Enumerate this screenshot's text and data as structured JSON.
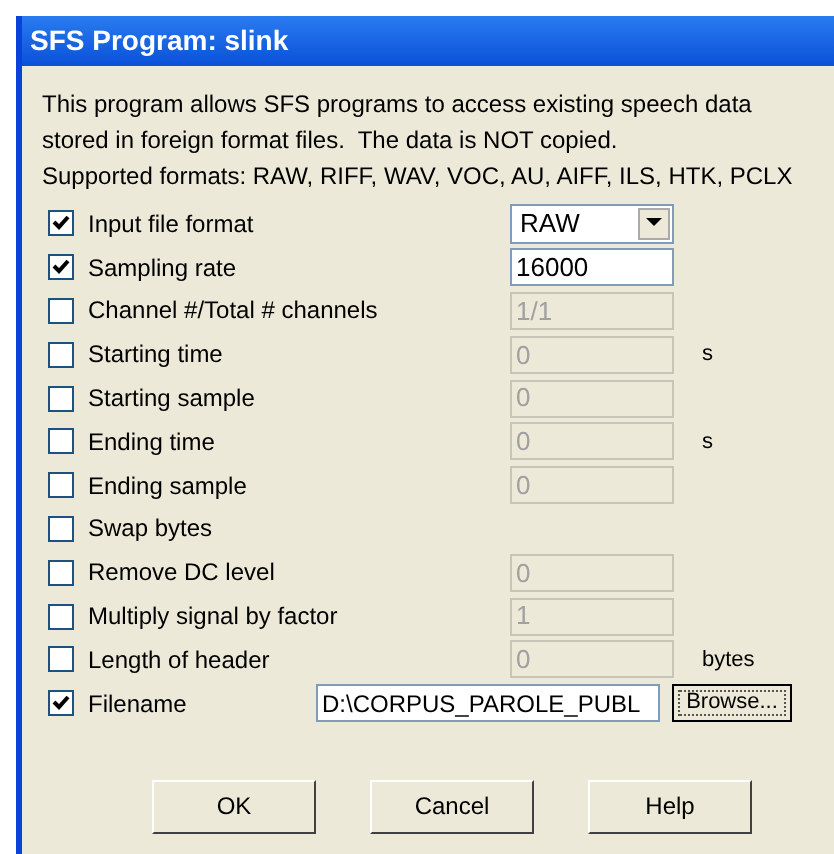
{
  "window": {
    "title": "SFS Program: slink"
  },
  "description": [
    "This program allows SFS programs to access existing speech data",
    "stored in foreign format files.  The data is NOT copied.",
    "Supported formats: RAW, RIFF, WAV, VOC, AU, AIFF, ILS, HTK, PCLX"
  ],
  "options": [
    {
      "label": "Input file format",
      "checked": true,
      "kind": "select",
      "value": "RAW",
      "disabled": false
    },
    {
      "label": "Sampling rate",
      "checked": true,
      "kind": "input",
      "value": "16000",
      "disabled": false
    },
    {
      "label": "Channel #/Total # channels",
      "checked": false,
      "kind": "input",
      "value": "1/1",
      "disabled": true
    },
    {
      "label": "Starting time",
      "checked": false,
      "kind": "input",
      "value": "0",
      "disabled": true,
      "unit": "s"
    },
    {
      "label": "Starting sample",
      "checked": false,
      "kind": "input",
      "value": "0",
      "disabled": true
    },
    {
      "label": "Ending time",
      "checked": false,
      "kind": "input",
      "value": "0",
      "disabled": true,
      "unit": "s"
    },
    {
      "label": "Ending sample",
      "checked": false,
      "kind": "input",
      "value": "0",
      "disabled": true
    },
    {
      "label": "Swap bytes",
      "checked": false,
      "kind": "flag"
    },
    {
      "label": "Remove DC level",
      "checked": false,
      "kind": "input",
      "value": "0",
      "disabled": true
    },
    {
      "label": "Multiply signal by factor",
      "checked": false,
      "kind": "input",
      "value": "1",
      "disabled": true
    },
    {
      "label": "Length of header",
      "checked": false,
      "kind": "input",
      "value": "0",
      "disabled": true,
      "unit": "bytes"
    },
    {
      "label": "Filename",
      "checked": true,
      "kind": "file",
      "value": "D:\\CORPUS_PAROLE_PUBL",
      "disabled": false,
      "button": "Browse..."
    }
  ],
  "buttons": [
    "OK",
    "Cancel",
    "Help"
  ]
}
